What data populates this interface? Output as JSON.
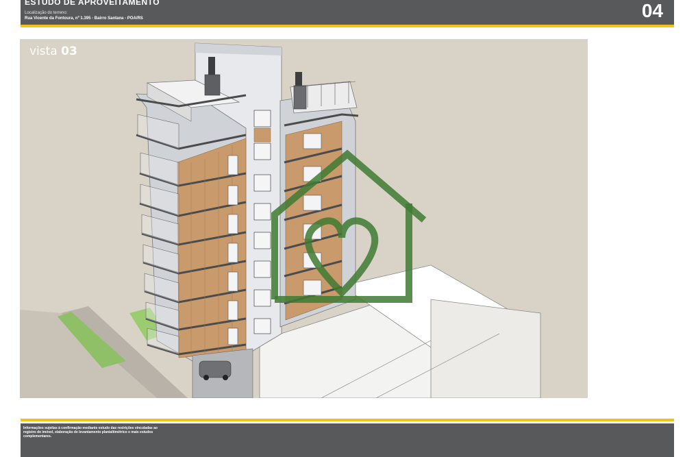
{
  "header": {
    "title": "ESTUDO DE APROVEITAMENTO",
    "location_label": "Localização do terreno:",
    "location_value": "Rua Vicente da Fontoura, nº 1.395 - Bairro Santana  - POA/RS",
    "page_number": "04"
  },
  "view": {
    "label_prefix": "vista ",
    "label_number": "03"
  },
  "footer": {
    "disclaimer": "Informações sujeitas à confirmação mediante estudo das restrições vinculadas ao registro do imóvel, elaboração de levantamento planialtimétrico e mais estudos complementares."
  },
  "colors": {
    "header_bg": "#58595b",
    "accent_yellow": "#f2c314",
    "view_bg": "#d8d3c6",
    "wood": "#c89a6c",
    "watermark_green": "#3f7a32"
  }
}
